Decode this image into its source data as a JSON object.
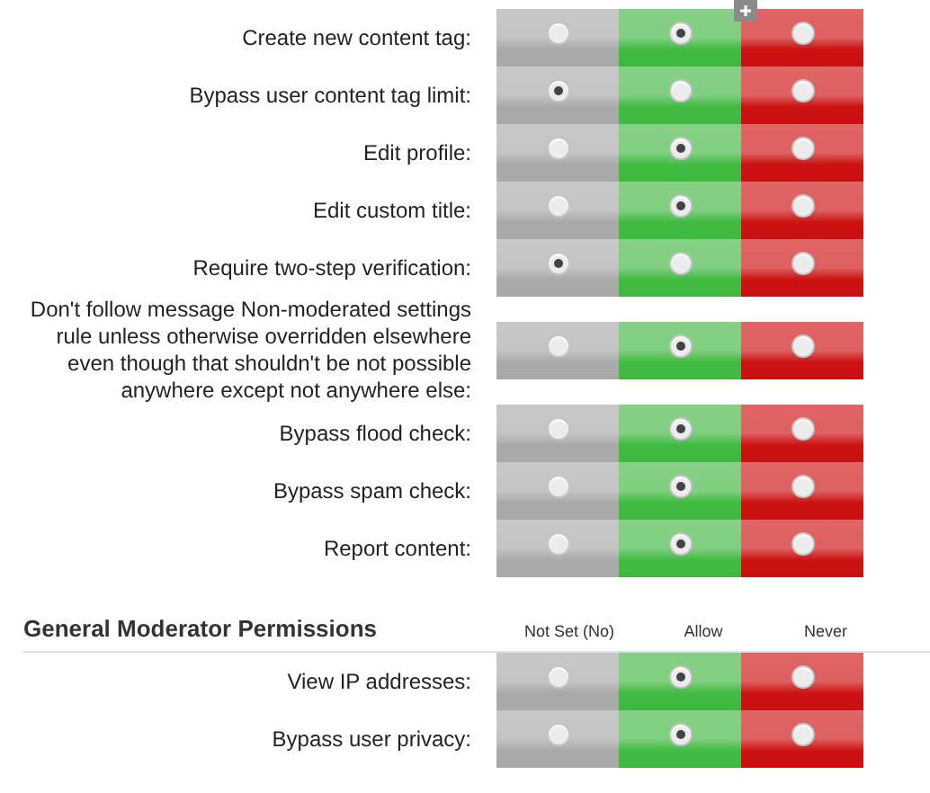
{
  "groups": [
    {
      "rows": [
        {
          "label": "Create new content tag:",
          "options": [
            {
              "selected": false
            },
            {
              "selected": true
            },
            {
              "selected": false
            }
          ]
        },
        {
          "label": "Bypass user content tag limit:",
          "options": [
            {
              "selected": true
            },
            {
              "selected": false
            },
            {
              "selected": false
            }
          ]
        },
        {
          "label": "Edit profile:",
          "options": [
            {
              "selected": false
            },
            {
              "selected": true
            },
            {
              "selected": false
            }
          ]
        },
        {
          "label": "Edit custom title:",
          "options": [
            {
              "selected": false
            },
            {
              "selected": true
            },
            {
              "selected": false
            }
          ]
        },
        {
          "label": "Require two-step verification:",
          "options": [
            {
              "selected": true
            },
            {
              "selected": false
            },
            {
              "selected": false
            }
          ]
        },
        {
          "label": "Don't follow message Non-moderated settings rule unless otherwise overridden elsewhere even though that shouldn't be not possible anywhere except not anywhere else:",
          "options": [
            {
              "selected": false
            },
            {
              "selected": true
            },
            {
              "selected": false
            }
          ]
        },
        {
          "label": "Bypass flood check:",
          "options": [
            {
              "selected": false
            },
            {
              "selected": true
            },
            {
              "selected": false
            }
          ]
        },
        {
          "label": "Bypass spam check:",
          "options": [
            {
              "selected": false
            },
            {
              "selected": true
            },
            {
              "selected": false
            }
          ]
        },
        {
          "label": "Report content:",
          "options": [
            {
              "selected": false
            },
            {
              "selected": true
            },
            {
              "selected": false
            }
          ]
        }
      ]
    },
    {
      "title": "General Moderator Permissions",
      "columns": [
        "Not Set (No)",
        "Allow",
        "Never"
      ],
      "rows": [
        {
          "label": "View IP addresses:",
          "options": [
            {
              "selected": false
            },
            {
              "selected": true
            },
            {
              "selected": false
            }
          ]
        },
        {
          "label": "Bypass user privacy:",
          "options": [
            {
              "selected": false
            },
            {
              "selected": true
            },
            {
              "selected": false
            }
          ]
        }
      ]
    }
  ]
}
